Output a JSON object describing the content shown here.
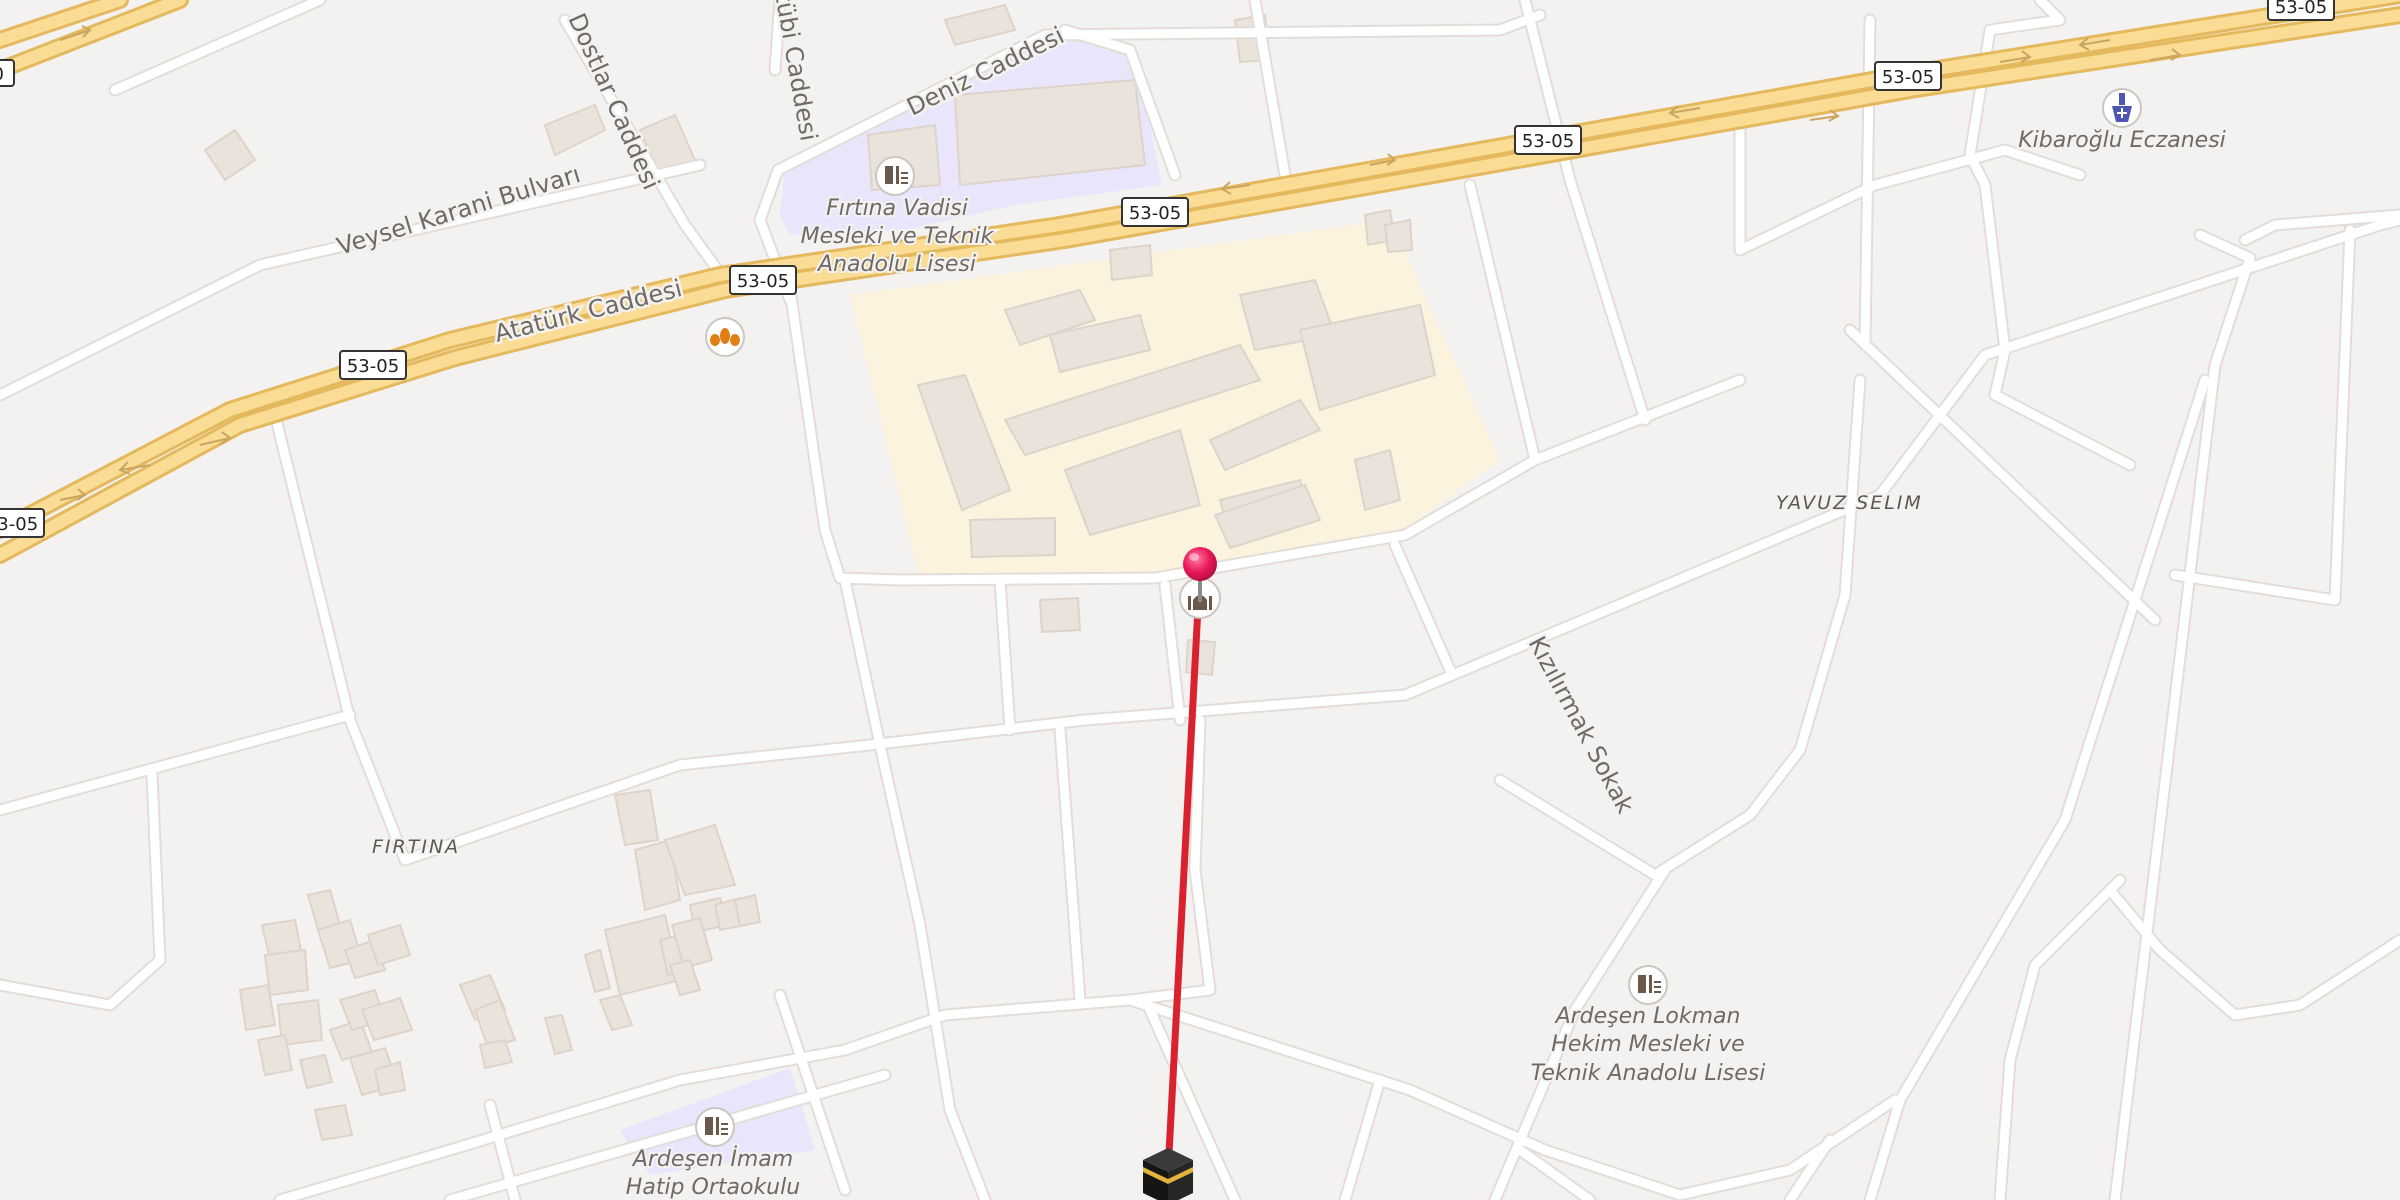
{
  "route_shield": "53-05",
  "streets": {
    "veysel": "Veysel Karani Bulvarı",
    "dostlar": "Dostlar Caddesi",
    "kutubi": "Kütübi Caddesi",
    "deniz": "Deniz Caddesi",
    "ataturk": "Atatürk Caddesi",
    "kizilirmak": "Kızılırmak Sokak"
  },
  "districts": {
    "fırtına": "FIRTINA",
    "yavuz": "YAVUZ SELIM"
  },
  "pois": {
    "firtina_school": [
      "Fırtına Vadisi",
      "Mesleki ve Teknik",
      "Anadolu Lisesi"
    ],
    "eczane": "Kibaroğlu Eczanesi",
    "lokman": [
      "Ardeşen Lokman",
      "Hekim Mesleki ve",
      "Teknik Anadolu Lisesi"
    ],
    "imam": [
      "Ardeşen İmam",
      "Hatip Ortaokulu"
    ]
  },
  "icons": [
    "school-icon",
    "bakery-icon",
    "pharmacy-icon",
    "mosque-icon",
    "kaaba-icon",
    "location-pin-icon"
  ],
  "colors": {
    "background": "#f4f2f0",
    "road": "#ffffff",
    "highway_fill": "#fbdc95",
    "highway_casing": "#e4b85d",
    "school_area": "#e9e5fb",
    "campus_area": "#fbf3de",
    "building": "#eae3dc",
    "qibla_line": "#d9222e",
    "pin": "#e8195a"
  }
}
